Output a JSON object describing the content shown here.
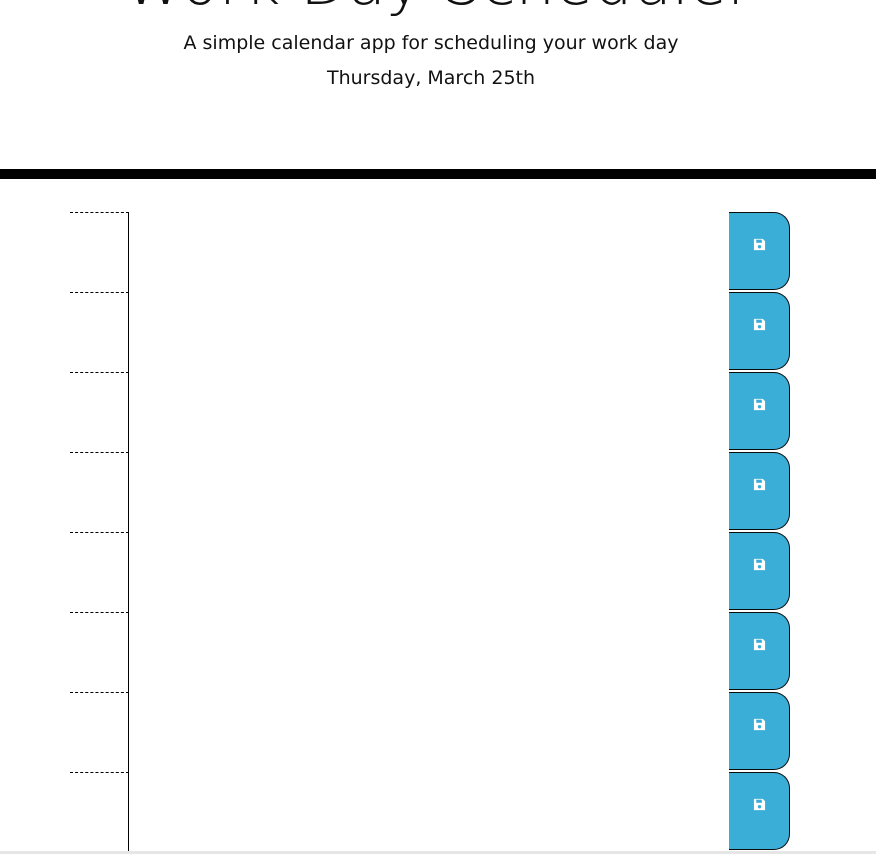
{
  "header": {
    "title": "Work Day Scheduler",
    "subtitle": "A simple calendar app for scheduling your work day",
    "current_day": "Thursday, March 25th"
  },
  "save_icon": "floppy-disk-icon",
  "colors": {
    "save_button": "#3aaed7",
    "header_border": "#000000"
  },
  "time_blocks": [
    {
      "hour": "",
      "text": ""
    },
    {
      "hour": "",
      "text": ""
    },
    {
      "hour": "",
      "text": ""
    },
    {
      "hour": "",
      "text": ""
    },
    {
      "hour": "",
      "text": ""
    },
    {
      "hour": "",
      "text": ""
    },
    {
      "hour": "",
      "text": ""
    },
    {
      "hour": "",
      "text": ""
    }
  ]
}
